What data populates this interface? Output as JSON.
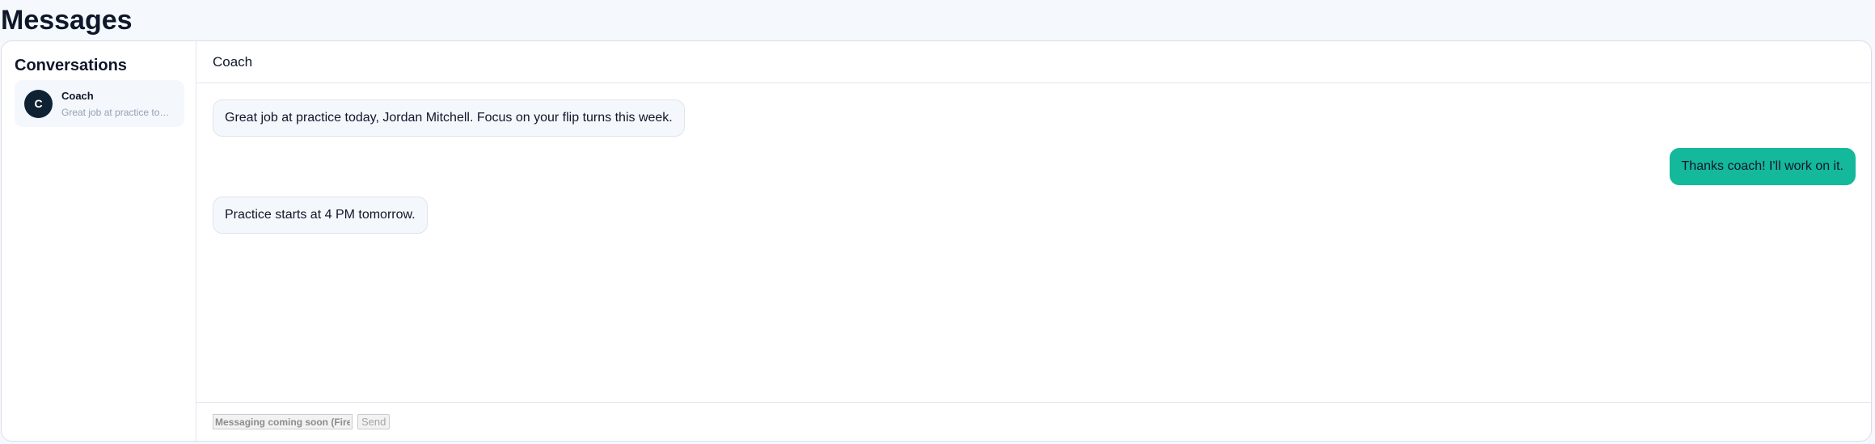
{
  "page": {
    "title": "Messages"
  },
  "sidebar": {
    "title": "Conversations",
    "conversations": [
      {
        "avatar_letter": "C",
        "name": "Coach",
        "preview": "Great job at practice today, Jordan Mitchell. Focus on your flip turns this week."
      }
    ]
  },
  "chat": {
    "header_title": "Coach",
    "messages": [
      {
        "direction": "incoming",
        "text": "Great job at practice today, Jordan Mitchell. Focus on your flip turns this week."
      },
      {
        "direction": "outgoing",
        "text": "Thanks coach! I'll work on it."
      },
      {
        "direction": "incoming",
        "text": "Practice starts at 4 PM tomorrow."
      }
    ]
  },
  "composer": {
    "placeholder": "Messaging coming soon (Firebase)",
    "send_label": "Send"
  },
  "colors": {
    "outgoing_bubble": "#14b89a",
    "avatar_bg": "#0f2233",
    "page_bg": "#f5f9fd"
  }
}
